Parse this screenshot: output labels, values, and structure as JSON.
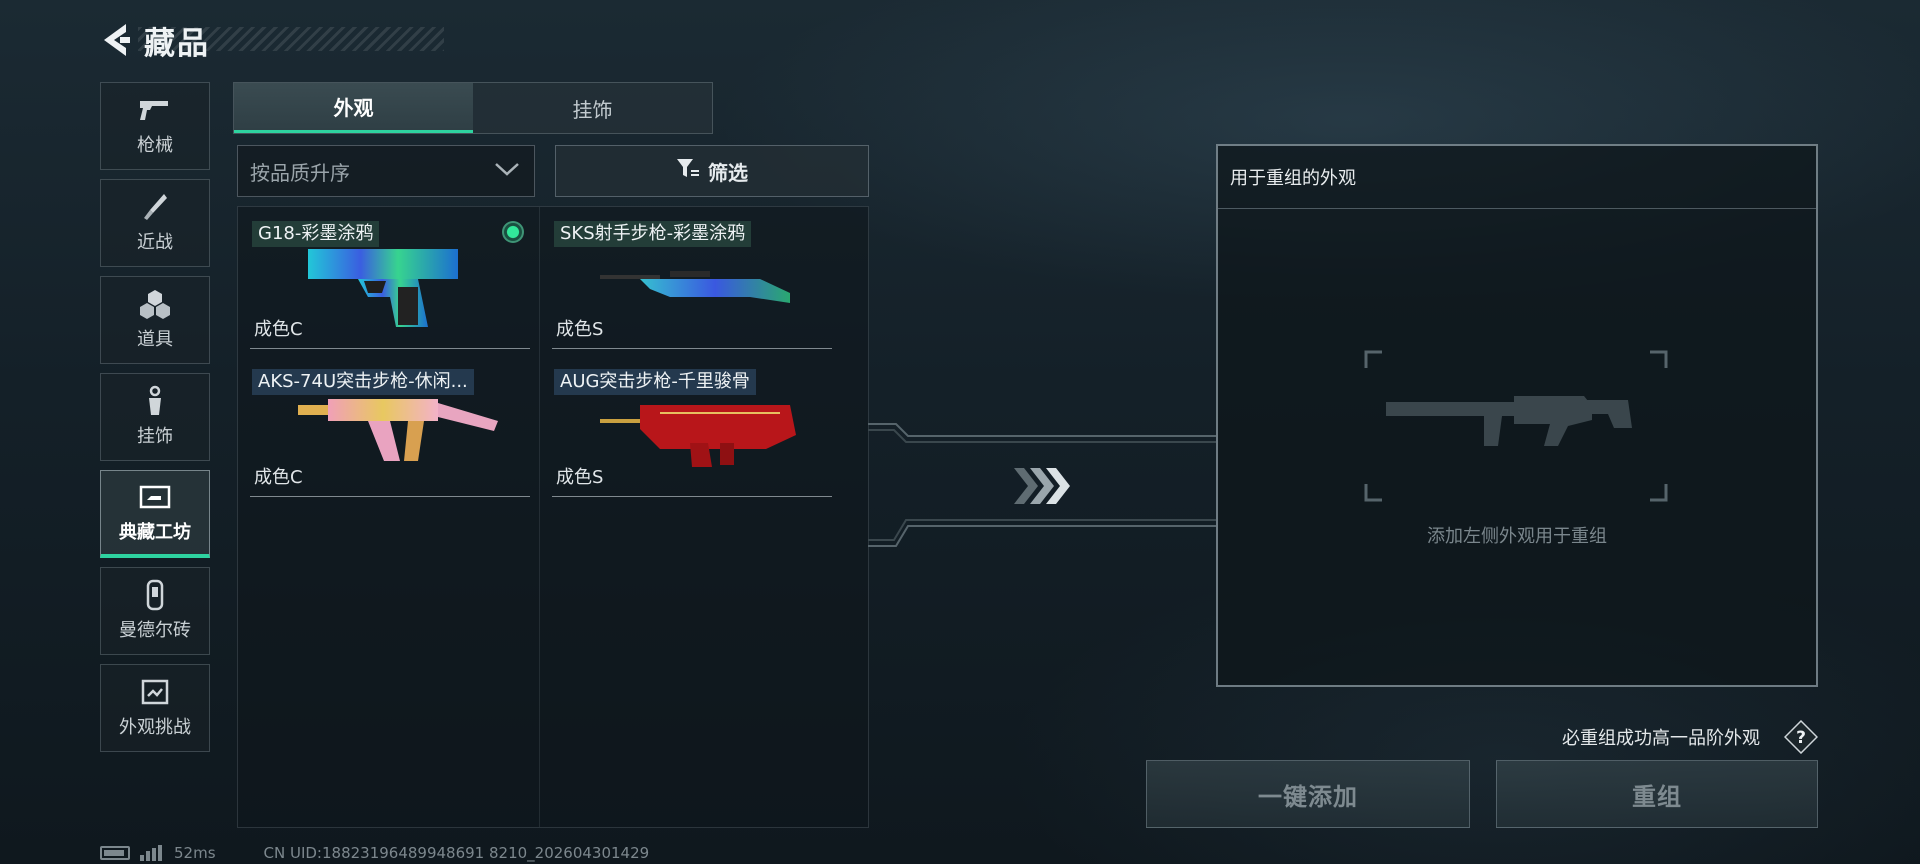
{
  "header": {
    "title": "藏品"
  },
  "nav": {
    "items": [
      {
        "label": "枪械",
        "icon": "pistol-icon"
      },
      {
        "label": "近战",
        "icon": "knife-icon"
      },
      {
        "label": "道具",
        "icon": "cubes-icon"
      },
      {
        "label": "挂饰",
        "icon": "keychain-icon"
      },
      {
        "label": "典藏工坊",
        "icon": "workshop-icon",
        "active": true
      },
      {
        "label": "曼德尔砖",
        "icon": "brick-icon"
      },
      {
        "label": "外观挑战",
        "icon": "challenge-icon"
      }
    ]
  },
  "tabs": [
    {
      "label": "外观",
      "active": true
    },
    {
      "label": "挂饰",
      "active": false
    }
  ],
  "sort": {
    "label": "按品质升序"
  },
  "filter": {
    "label": "筛选"
  },
  "items": [
    {
      "name": "G18-彩墨涂鸦",
      "grade": "成色C",
      "selected": true
    },
    {
      "name": "SKS射手步枪-彩墨涂鸦",
      "grade": "成色S",
      "selected": false
    },
    {
      "name": "AKS-74U突击步枪-休闲...",
      "grade": "成色C",
      "selected": false
    },
    {
      "name": "AUG突击步枪-千里骏骨",
      "grade": "成色S",
      "selected": false
    }
  ],
  "panel": {
    "title": "用于重组的外观",
    "hint": "添加左侧外观用于重组"
  },
  "actions": {
    "guarantee": "必重组成功高一品阶外观",
    "help": "?",
    "add_all": "一键添加",
    "recombine": "重组"
  },
  "status": {
    "ping": "52ms",
    "uid": "CN UID:18823196489948691 8210_202604301429"
  },
  "colors": {
    "accent": "#2ed3a0",
    "selected_dot": "#32e89a"
  }
}
